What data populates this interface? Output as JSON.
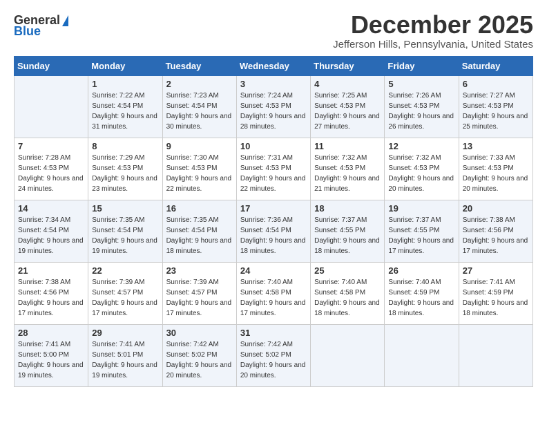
{
  "logo": {
    "general": "General",
    "blue": "Blue"
  },
  "title": "December 2025",
  "location": "Jefferson Hills, Pennsylvania, United States",
  "days_header": [
    "Sunday",
    "Monday",
    "Tuesday",
    "Wednesday",
    "Thursday",
    "Friday",
    "Saturday"
  ],
  "weeks": [
    [
      {
        "num": "",
        "sunrise": "",
        "sunset": "",
        "daylight": ""
      },
      {
        "num": "1",
        "sunrise": "Sunrise: 7:22 AM",
        "sunset": "Sunset: 4:54 PM",
        "daylight": "Daylight: 9 hours and 31 minutes."
      },
      {
        "num": "2",
        "sunrise": "Sunrise: 7:23 AM",
        "sunset": "Sunset: 4:54 PM",
        "daylight": "Daylight: 9 hours and 30 minutes."
      },
      {
        "num": "3",
        "sunrise": "Sunrise: 7:24 AM",
        "sunset": "Sunset: 4:53 PM",
        "daylight": "Daylight: 9 hours and 28 minutes."
      },
      {
        "num": "4",
        "sunrise": "Sunrise: 7:25 AM",
        "sunset": "Sunset: 4:53 PM",
        "daylight": "Daylight: 9 hours and 27 minutes."
      },
      {
        "num": "5",
        "sunrise": "Sunrise: 7:26 AM",
        "sunset": "Sunset: 4:53 PM",
        "daylight": "Daylight: 9 hours and 26 minutes."
      },
      {
        "num": "6",
        "sunrise": "Sunrise: 7:27 AM",
        "sunset": "Sunset: 4:53 PM",
        "daylight": "Daylight: 9 hours and 25 minutes."
      }
    ],
    [
      {
        "num": "7",
        "sunrise": "Sunrise: 7:28 AM",
        "sunset": "Sunset: 4:53 PM",
        "daylight": "Daylight: 9 hours and 24 minutes."
      },
      {
        "num": "8",
        "sunrise": "Sunrise: 7:29 AM",
        "sunset": "Sunset: 4:53 PM",
        "daylight": "Daylight: 9 hours and 23 minutes."
      },
      {
        "num": "9",
        "sunrise": "Sunrise: 7:30 AM",
        "sunset": "Sunset: 4:53 PM",
        "daylight": "Daylight: 9 hours and 22 minutes."
      },
      {
        "num": "10",
        "sunrise": "Sunrise: 7:31 AM",
        "sunset": "Sunset: 4:53 PM",
        "daylight": "Daylight: 9 hours and 22 minutes."
      },
      {
        "num": "11",
        "sunrise": "Sunrise: 7:32 AM",
        "sunset": "Sunset: 4:53 PM",
        "daylight": "Daylight: 9 hours and 21 minutes."
      },
      {
        "num": "12",
        "sunrise": "Sunrise: 7:32 AM",
        "sunset": "Sunset: 4:53 PM",
        "daylight": "Daylight: 9 hours and 20 minutes."
      },
      {
        "num": "13",
        "sunrise": "Sunrise: 7:33 AM",
        "sunset": "Sunset: 4:53 PM",
        "daylight": "Daylight: 9 hours and 20 minutes."
      }
    ],
    [
      {
        "num": "14",
        "sunrise": "Sunrise: 7:34 AM",
        "sunset": "Sunset: 4:54 PM",
        "daylight": "Daylight: 9 hours and 19 minutes."
      },
      {
        "num": "15",
        "sunrise": "Sunrise: 7:35 AM",
        "sunset": "Sunset: 4:54 PM",
        "daylight": "Daylight: 9 hours and 19 minutes."
      },
      {
        "num": "16",
        "sunrise": "Sunrise: 7:35 AM",
        "sunset": "Sunset: 4:54 PM",
        "daylight": "Daylight: 9 hours and 18 minutes."
      },
      {
        "num": "17",
        "sunrise": "Sunrise: 7:36 AM",
        "sunset": "Sunset: 4:54 PM",
        "daylight": "Daylight: 9 hours and 18 minutes."
      },
      {
        "num": "18",
        "sunrise": "Sunrise: 7:37 AM",
        "sunset": "Sunset: 4:55 PM",
        "daylight": "Daylight: 9 hours and 18 minutes."
      },
      {
        "num": "19",
        "sunrise": "Sunrise: 7:37 AM",
        "sunset": "Sunset: 4:55 PM",
        "daylight": "Daylight: 9 hours and 17 minutes."
      },
      {
        "num": "20",
        "sunrise": "Sunrise: 7:38 AM",
        "sunset": "Sunset: 4:56 PM",
        "daylight": "Daylight: 9 hours and 17 minutes."
      }
    ],
    [
      {
        "num": "21",
        "sunrise": "Sunrise: 7:38 AM",
        "sunset": "Sunset: 4:56 PM",
        "daylight": "Daylight: 9 hours and 17 minutes."
      },
      {
        "num": "22",
        "sunrise": "Sunrise: 7:39 AM",
        "sunset": "Sunset: 4:57 PM",
        "daylight": "Daylight: 9 hours and 17 minutes."
      },
      {
        "num": "23",
        "sunrise": "Sunrise: 7:39 AM",
        "sunset": "Sunset: 4:57 PM",
        "daylight": "Daylight: 9 hours and 17 minutes."
      },
      {
        "num": "24",
        "sunrise": "Sunrise: 7:40 AM",
        "sunset": "Sunset: 4:58 PM",
        "daylight": "Daylight: 9 hours and 17 minutes."
      },
      {
        "num": "25",
        "sunrise": "Sunrise: 7:40 AM",
        "sunset": "Sunset: 4:58 PM",
        "daylight": "Daylight: 9 hours and 18 minutes."
      },
      {
        "num": "26",
        "sunrise": "Sunrise: 7:40 AM",
        "sunset": "Sunset: 4:59 PM",
        "daylight": "Daylight: 9 hours and 18 minutes."
      },
      {
        "num": "27",
        "sunrise": "Sunrise: 7:41 AM",
        "sunset": "Sunset: 4:59 PM",
        "daylight": "Daylight: 9 hours and 18 minutes."
      }
    ],
    [
      {
        "num": "28",
        "sunrise": "Sunrise: 7:41 AM",
        "sunset": "Sunset: 5:00 PM",
        "daylight": "Daylight: 9 hours and 19 minutes."
      },
      {
        "num": "29",
        "sunrise": "Sunrise: 7:41 AM",
        "sunset": "Sunset: 5:01 PM",
        "daylight": "Daylight: 9 hours and 19 minutes."
      },
      {
        "num": "30",
        "sunrise": "Sunrise: 7:42 AM",
        "sunset": "Sunset: 5:02 PM",
        "daylight": "Daylight: 9 hours and 20 minutes."
      },
      {
        "num": "31",
        "sunrise": "Sunrise: 7:42 AM",
        "sunset": "Sunset: 5:02 PM",
        "daylight": "Daylight: 9 hours and 20 minutes."
      },
      {
        "num": "",
        "sunrise": "",
        "sunset": "",
        "daylight": ""
      },
      {
        "num": "",
        "sunrise": "",
        "sunset": "",
        "daylight": ""
      },
      {
        "num": "",
        "sunrise": "",
        "sunset": "",
        "daylight": ""
      }
    ]
  ]
}
